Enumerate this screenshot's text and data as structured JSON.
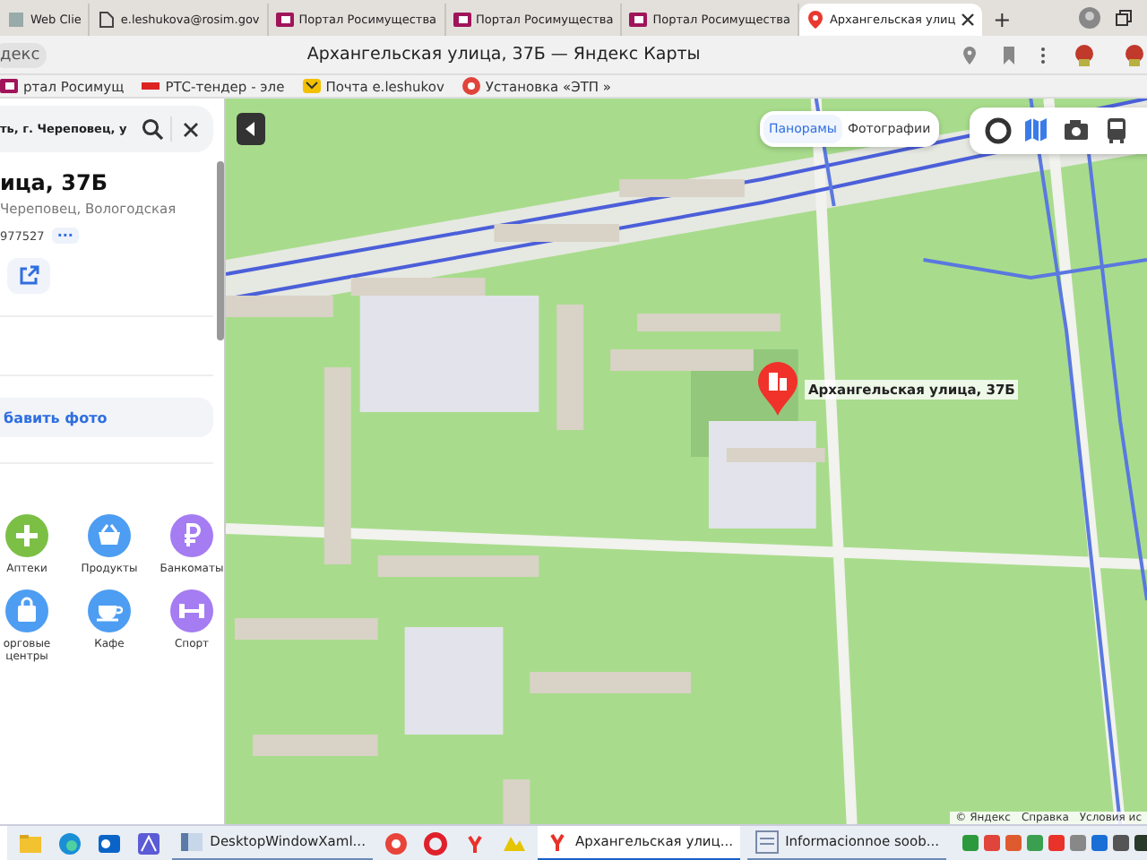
{
  "browser": {
    "tabs": [
      {
        "title": "Web Clie",
        "kind": "plain",
        "selected": false
      },
      {
        "title": "e.leshukova@rosim.gov",
        "kind": "doc",
        "selected": false
      },
      {
        "title": "Портал Росимущества",
        "kind": "portal",
        "selected": false
      },
      {
        "title": "Портал Росимущества",
        "kind": "portal",
        "selected": false
      },
      {
        "title": "Портал Росимущества",
        "kind": "portal",
        "selected": false
      },
      {
        "title": "Архангельская улиц",
        "kind": "map",
        "selected": true
      }
    ],
    "new_tab": "+",
    "address_left": "декс",
    "address_title": "Архангельская улица, 37Б — Яндекс Карты",
    "bookmarks": [
      {
        "title": "ртал Росимущ",
        "kind": "portal"
      },
      {
        "title": "РТС-тендер - эле",
        "kind": "rts"
      },
      {
        "title": "Почта e.leshukov",
        "kind": "mail"
      },
      {
        "title": "Установка «ЭТП »",
        "kind": "etp"
      }
    ]
  },
  "panel": {
    "search": {
      "value": "ть, г. Череповец, у"
    },
    "title": "ица, 37Б",
    "address": "Череповец, Вологодская",
    "code": "977527",
    "more": "···",
    "add_photo": "бавить фото",
    "categories": [
      {
        "label": "Аптеки",
        "kind": "plus",
        "color": "#7cbf45"
      },
      {
        "label": "Продукты",
        "kind": "basket",
        "color": "#4d9df2"
      },
      {
        "label": "Банкоматы",
        "kind": "ruble",
        "color": "#a57cf2"
      },
      {
        "label": "орговые центры",
        "kind": "bag",
        "color": "#4d9df2"
      },
      {
        "label": "Кафе",
        "kind": "cup",
        "color": "#4d9df2"
      },
      {
        "label": "Спорт",
        "kind": "dumbbell",
        "color": "#a57cf2"
      }
    ]
  },
  "map": {
    "view_tabs": [
      {
        "label": "Панорамы",
        "selected": true
      },
      {
        "label": "Фотографии",
        "selected": false
      }
    ],
    "marker_label": "Архангельская улица, 37Б",
    "attribution": [
      "© Яндекс",
      "Справка",
      "Условия ис"
    ]
  },
  "taskbar": {
    "apps": [
      {
        "label": "DesktopWindowXaml...",
        "selected": false
      },
      {
        "label": "Архангельская улиц...",
        "selected": true
      },
      {
        "label": "Informacionnoe soob...",
        "selected": false
      }
    ]
  }
}
